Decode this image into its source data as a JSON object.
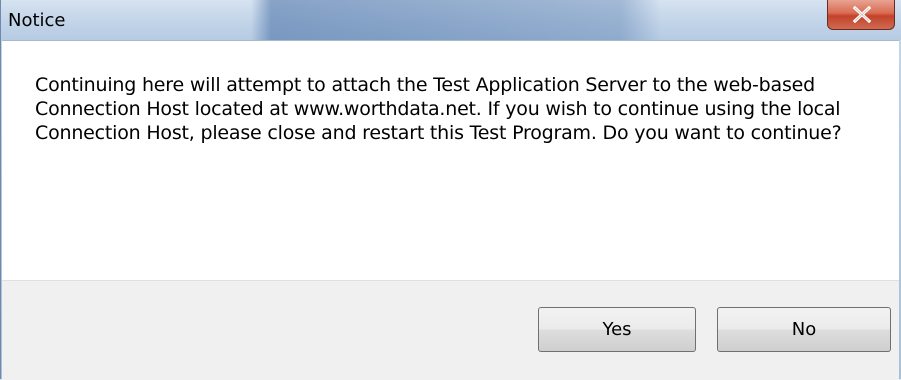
{
  "window": {
    "title": "Notice"
  },
  "dialog": {
    "message": "Continuing here will attempt to attach the Test Application Server to the web-based Connection Host located at www.worthdata.net. If you wish to continue using the local Connection Host, please close and restart this Test Program. Do you want to continue?"
  },
  "buttons": {
    "yes_label": "Yes",
    "no_label": "No"
  },
  "icons": {
    "close": "close-icon"
  },
  "colors": {
    "close_button": "#d0553e",
    "content_background": "#ffffff",
    "footer_background": "#f0f0f0"
  }
}
